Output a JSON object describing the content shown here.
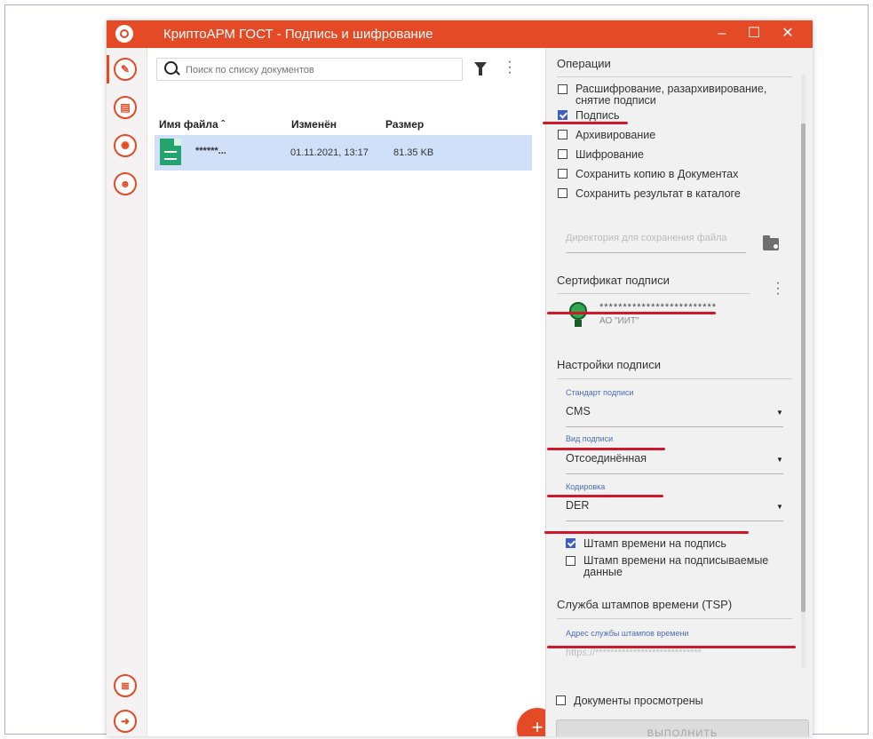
{
  "window": {
    "title": "КриптоАРМ ГОСТ - Подпись и шифрование",
    "minimize": "–",
    "maximize": "☐",
    "close": "✕"
  },
  "sidebar": {
    "top_items": [
      {
        "icon": "pen-sign-icon",
        "glyph": "✎"
      },
      {
        "icon": "document-icon",
        "glyph": "▤"
      },
      {
        "icon": "certificate-icon",
        "glyph": "✺"
      },
      {
        "icon": "contacts-icon",
        "glyph": "☻"
      }
    ],
    "bottom_items": [
      {
        "icon": "journal-icon",
        "glyph": "≣"
      },
      {
        "icon": "exit-icon",
        "glyph": "➜"
      }
    ]
  },
  "documents": {
    "search_placeholder": "Поиск по списку документов",
    "columns": {
      "name": "Имя файла ˆ",
      "modified": "Изменён",
      "size": "Размер"
    },
    "rows": [
      {
        "name": "******...",
        "modified": "01.11.2021, 13:17",
        "size": "81.35 KB"
      }
    ],
    "fab": "+"
  },
  "operations": {
    "title": "Операции",
    "options": [
      {
        "label": "Расшифрование, разархивирование, снятие подписи",
        "checked": false
      },
      {
        "label": "Подпись",
        "checked": true
      },
      {
        "label": "Архивирование",
        "checked": false
      },
      {
        "label": "Шифрование",
        "checked": false
      },
      {
        "label": "Сохранить копию в Документах",
        "checked": false
      },
      {
        "label": "Сохранить результат в каталоге",
        "checked": false
      }
    ],
    "dir_placeholder": "Директория для сохранения файла"
  },
  "certificate": {
    "title": "Сертификат подписи",
    "name": "*************************",
    "issuer": "АО \"ИИТ\""
  },
  "sign_settings": {
    "title": "Настройки подписи",
    "standard_label": "Стандарт подписи",
    "standard_value": "CMS",
    "type_label": "Вид подписи",
    "type_value": "Отсоединённая",
    "encoding_label": "Кодировка",
    "encoding_value": "DER",
    "timestamp_sign": "Штамп времени на подпись",
    "timestamp_sign_checked": true,
    "timestamp_data": "Штамп времени на подписываемые данные",
    "timestamp_data_checked": false
  },
  "tsp": {
    "title": "Служба штампов времени (TSP)",
    "address_label": "Адрес службы штампов времени",
    "address_value": "https://****************************"
  },
  "footer": {
    "docs_viewed": "Документы просмотрены",
    "execute": "ВЫПОЛНИТЬ"
  },
  "colors": {
    "accent": "#e44a26",
    "highlight": "#d1172a",
    "selected_row": "#cfe0f8",
    "checkbox": "#3d5ec3"
  }
}
